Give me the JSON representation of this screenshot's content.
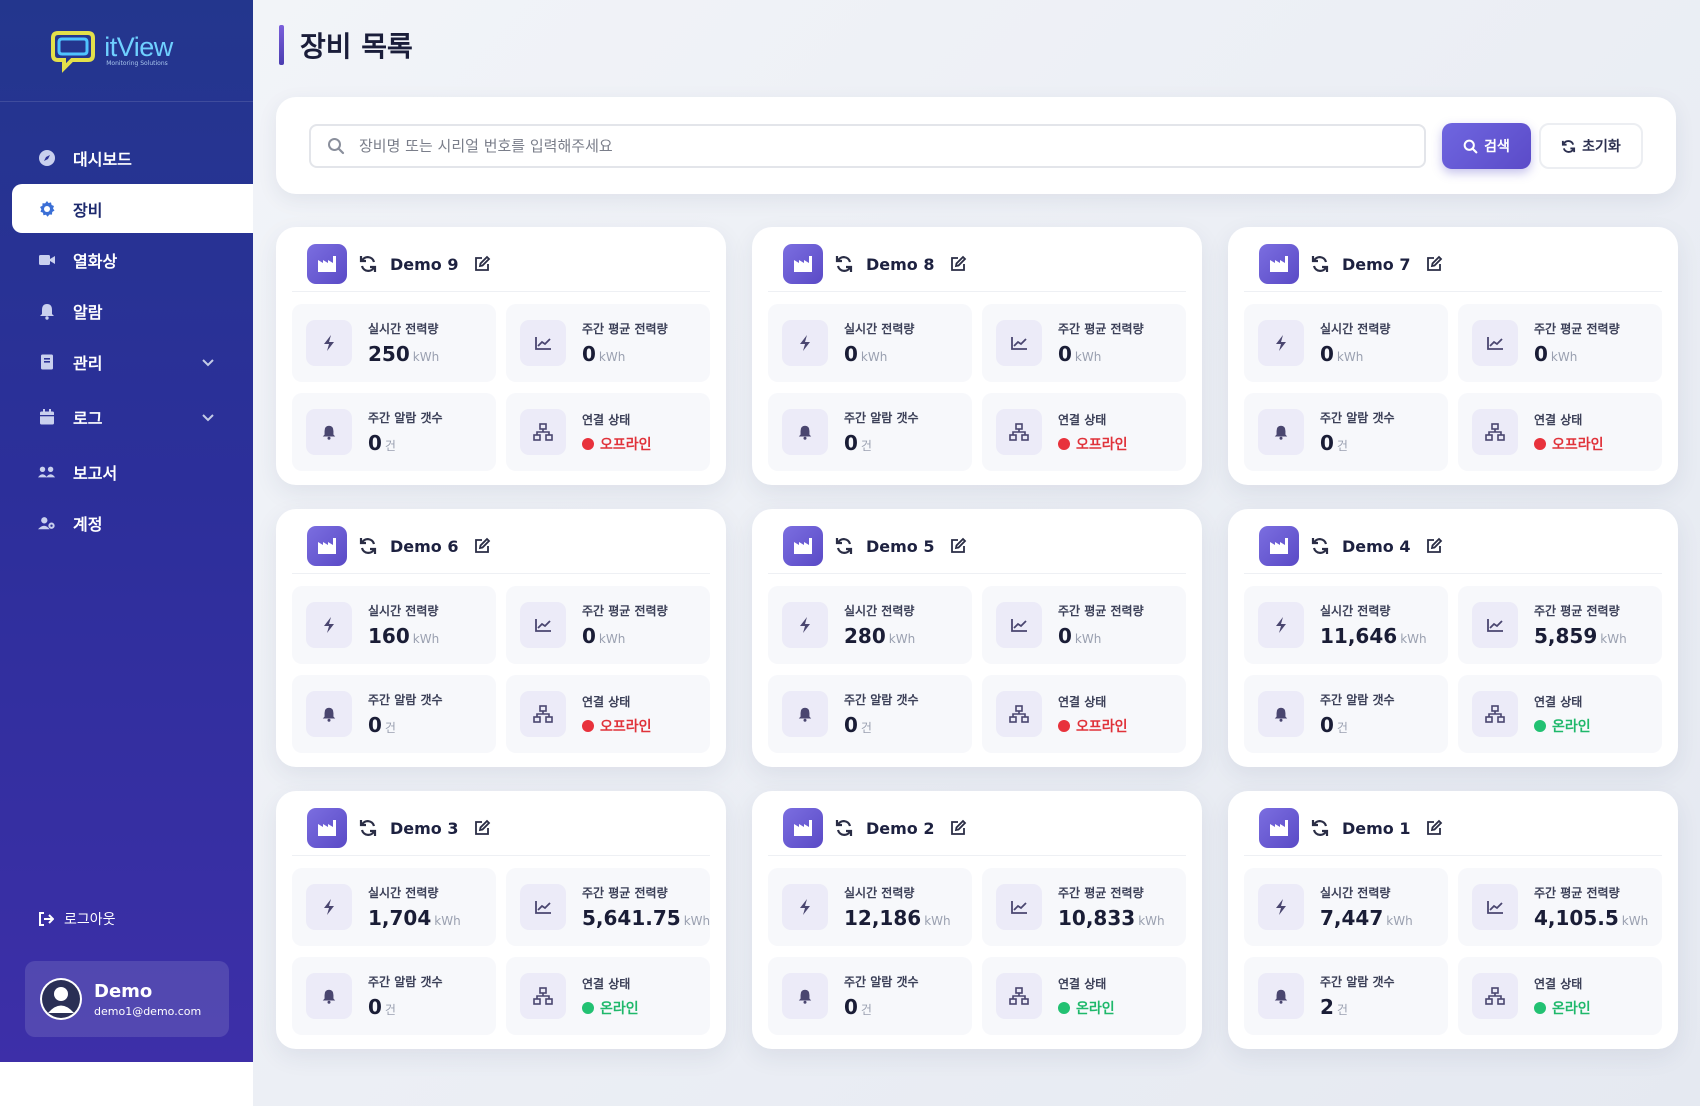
{
  "logo": {
    "name": "itView",
    "tagline": "Monitoring Solutions"
  },
  "nav": [
    {
      "label": "대시보드",
      "icon": "compass-icon"
    },
    {
      "label": "장비",
      "icon": "gear-icon",
      "active": true
    },
    {
      "label": "열화상",
      "icon": "video-camera-icon"
    },
    {
      "label": "알람",
      "icon": "bell-icon"
    },
    {
      "label": "관리",
      "icon": "book-icon",
      "expandable": true
    },
    {
      "label": "로그",
      "icon": "calendar-icon",
      "expandable": true
    },
    {
      "label": "보고서",
      "icon": "users-gear-icon"
    },
    {
      "label": "계정",
      "icon": "user-gear-icon"
    }
  ],
  "logout_label": "로그아웃",
  "user": {
    "name": "Demo",
    "email": "demo1@demo.com"
  },
  "page_title": "장비 목록",
  "search": {
    "placeholder": "장비명 또는 시리얼 번호를 입력해주세요",
    "value": "",
    "search_label": "검색",
    "reset_label": "초기화"
  },
  "labels": {
    "realtime_power": "실시간 전력량",
    "weekly_avg_power": "주간 평균 전력량",
    "weekly_alarm_count": "주간 알람 갯수",
    "connection_status": "연결 상태",
    "power_unit": "kWh",
    "count_unit": "건"
  },
  "colors": {
    "offline": "#e8323c",
    "online": "#22c172",
    "accent": "#5b4bc8",
    "sidebar": "#2c2f9a"
  },
  "devices": [
    {
      "name": "Demo 9",
      "realtime": "250",
      "weekly_avg": "0",
      "alarms": "0",
      "status": "오프라인",
      "online": false
    },
    {
      "name": "Demo 8",
      "realtime": "0",
      "weekly_avg": "0",
      "alarms": "0",
      "status": "오프라인",
      "online": false
    },
    {
      "name": "Demo 7",
      "realtime": "0",
      "weekly_avg": "0",
      "alarms": "0",
      "status": "오프라인",
      "online": false
    },
    {
      "name": "Demo 6",
      "realtime": "160",
      "weekly_avg": "0",
      "alarms": "0",
      "status": "오프라인",
      "online": false
    },
    {
      "name": "Demo 5",
      "realtime": "280",
      "weekly_avg": "0",
      "alarms": "0",
      "status": "오프라인",
      "online": false
    },
    {
      "name": "Demo 4",
      "realtime": "11,646",
      "weekly_avg": "5,859",
      "alarms": "0",
      "status": "온라인",
      "online": true
    },
    {
      "name": "Demo 3",
      "realtime": "1,704",
      "weekly_avg": "5,641.75",
      "alarms": "0",
      "status": "온라인",
      "online": true
    },
    {
      "name": "Demo 2",
      "realtime": "12,186",
      "weekly_avg": "10,833",
      "alarms": "0",
      "status": "온라인",
      "online": true
    },
    {
      "name": "Demo 1",
      "realtime": "7,447",
      "weekly_avg": "4,105.5",
      "alarms": "2",
      "status": "온라인",
      "online": true
    }
  ]
}
